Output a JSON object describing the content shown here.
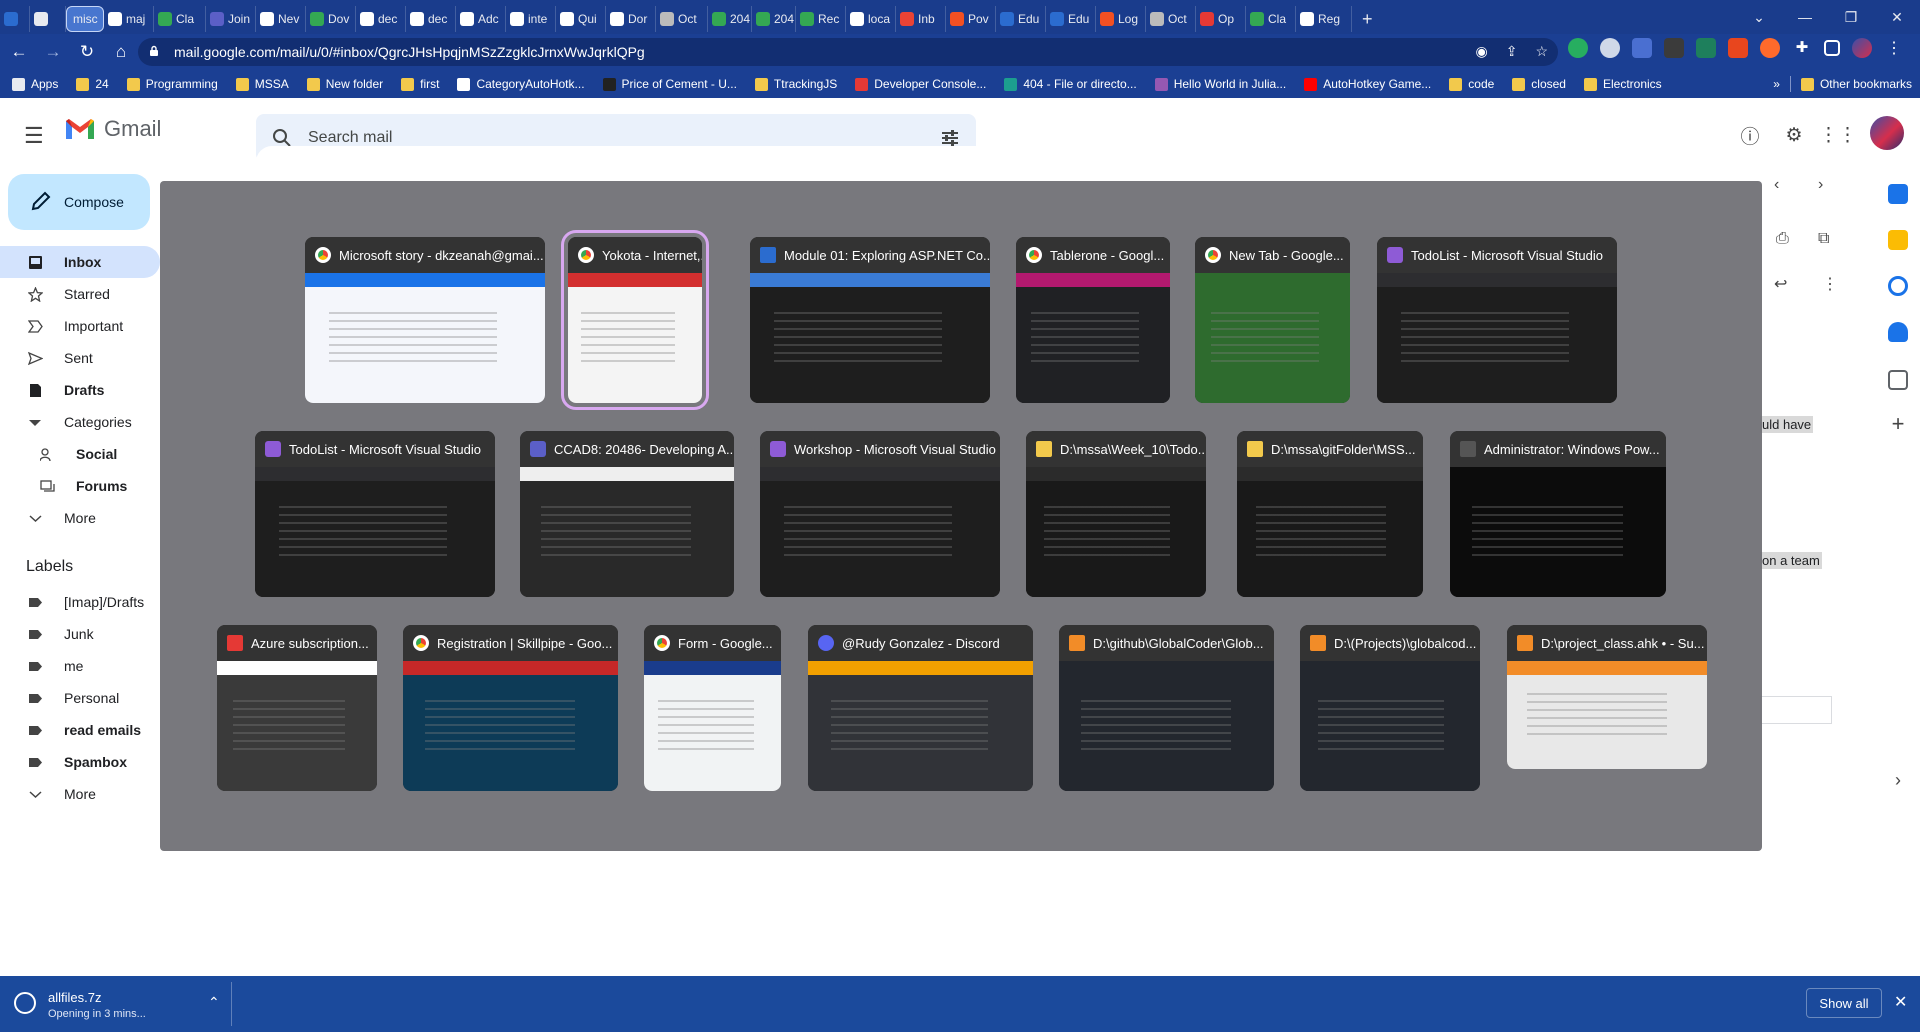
{
  "browser": {
    "tabs": [
      {
        "label": "",
        "icon": "app-icon",
        "color": "#2b6ccf"
      },
      {
        "label": "",
        "icon": "calendar-icon",
        "color": "#e8eaf0"
      },
      {
        "label": "misc",
        "icon": "",
        "color": "",
        "active": true
      },
      {
        "label": "maj",
        "icon": "github-icon",
        "color": "#ffffff"
      },
      {
        "label": "Cla",
        "icon": "check-icon",
        "color": "#34a853"
      },
      {
        "label": "Join",
        "icon": "teams-icon",
        "color": "#5b5fc7"
      },
      {
        "label": "Nev",
        "icon": "chrome-icon",
        "color": "#ffffff"
      },
      {
        "label": "Dov",
        "icon": "shield-icon",
        "color": "#34a853"
      },
      {
        "label": "dec",
        "icon": "google-icon",
        "color": "#ffffff"
      },
      {
        "label": "dec",
        "icon": "a-icon",
        "color": "#ffffff"
      },
      {
        "label": "Adc",
        "icon": "a-icon",
        "color": "#ffffff"
      },
      {
        "label": "inte",
        "icon": "google-icon",
        "color": "#ffffff"
      },
      {
        "label": "Qui",
        "icon": "a-icon",
        "color": "#ffffff"
      },
      {
        "label": "Dor",
        "icon": "github-icon",
        "color": "#ffffff"
      },
      {
        "label": "Oct",
        "icon": "octo-icon",
        "color": "#bbbbbb"
      },
      {
        "label": "204",
        "icon": "check-icon",
        "color": "#34a853"
      },
      {
        "label": "204",
        "icon": "check-icon",
        "color": "#34a853"
      },
      {
        "label": "Rec",
        "icon": "check-icon",
        "color": "#34a853"
      },
      {
        "label": "loca",
        "icon": "globe-icon",
        "color": "#ffffff"
      },
      {
        "label": "Inb",
        "icon": "gmail-icon",
        "color": "#ea4335"
      },
      {
        "label": "Pov",
        "icon": "ms-icon",
        "color": "#f25022"
      },
      {
        "label": "Edu",
        "icon": "a-icon",
        "color": "#2b6ccf"
      },
      {
        "label": "Edu",
        "icon": "a-icon",
        "color": "#2b6ccf"
      },
      {
        "label": "Log",
        "icon": "ms-icon",
        "color": "#f25022"
      },
      {
        "label": "Oct",
        "icon": "octo-icon",
        "color": "#bbbbbb"
      },
      {
        "label": "Op",
        "icon": "pdf-icon",
        "color": "#e53935"
      },
      {
        "label": "Cla",
        "icon": "check-icon",
        "color": "#34a853"
      },
      {
        "label": "Reg",
        "icon": "doc-icon",
        "color": "#ffffff"
      }
    ],
    "new_tab": "+",
    "url": "mail.google.com/mail/u/0/#inbox/QgrcJHsHpqjnMSzZzgklcJrnxWwJqrklQPg",
    "bookmarks": [
      {
        "label": "Apps",
        "icon": "grid"
      },
      {
        "label": "24",
        "icon": "folder"
      },
      {
        "label": "Programming",
        "icon": "folder"
      },
      {
        "label": "MSSA",
        "icon": "folder"
      },
      {
        "label": "New folder",
        "icon": "folder"
      },
      {
        "label": "first",
        "icon": "folder"
      },
      {
        "label": "CategoryAutoHotk...",
        "icon": "page"
      },
      {
        "label": "Price of Cement - U...",
        "icon": "iw"
      },
      {
        "label": "TtrackingJS",
        "icon": "folder"
      },
      {
        "label": "Developer Console...",
        "icon": "a-red"
      },
      {
        "label": "404 - File or directo...",
        "icon": "p-teal"
      },
      {
        "label": "Hello World in Julia...",
        "icon": "julia"
      },
      {
        "label": "AutoHotkey Game...",
        "icon": "youtube"
      },
      {
        "label": "code",
        "icon": "folder"
      },
      {
        "label": "closed",
        "icon": "folder"
      },
      {
        "label": "Electronics",
        "icon": "folder"
      }
    ],
    "bookmarks_more": "»",
    "other_bookmarks": "Other bookmarks"
  },
  "gmail": {
    "app_name": "Gmail",
    "search_placeholder": "Search mail",
    "compose": "Compose",
    "nav": [
      {
        "label": "Inbox",
        "icon": "inbox-icon",
        "active": true
      },
      {
        "label": "Starred",
        "icon": "star-icon"
      },
      {
        "label": "Important",
        "icon": "important-icon"
      },
      {
        "label": "Sent",
        "icon": "send-icon"
      },
      {
        "label": "Drafts",
        "icon": "draft-icon",
        "bold": true
      },
      {
        "label": "Categories",
        "icon": "caret-down-icon"
      },
      {
        "label": "Social",
        "icon": "people-icon",
        "bold": true,
        "sub": true
      },
      {
        "label": "Forums",
        "icon": "forum-icon",
        "bold": true,
        "sub": true
      },
      {
        "label": "More",
        "icon": "chevron-down-icon"
      }
    ],
    "labels_heading": "Labels",
    "labels": [
      {
        "label": "[Imap]/Drafts"
      },
      {
        "label": "Junk"
      },
      {
        "label": "me"
      },
      {
        "label": "Personal"
      },
      {
        "label": "read emails",
        "bold": true
      },
      {
        "label": "Spambox",
        "bold": true
      },
      {
        "label": "More",
        "chevron": true
      }
    ],
    "snippets": [
      "uld have",
      "on a team"
    ]
  },
  "switcher": {
    "windows": [
      {
        "title": "Microsoft story - dkzeanah@gmai...",
        "app": "chrome",
        "thumb": "#f4f6fb",
        "accent": "#1a73e8"
      },
      {
        "title": "Yokota - Internet,...",
        "app": "chrome",
        "thumb": "#f4f4f4",
        "accent": "#d32f2f",
        "selected": true
      },
      {
        "title": "Module 01: Exploring ASP.NET Co...",
        "app": "video",
        "thumb": "#1e1e1e",
        "accent": "#3a7bd5"
      },
      {
        "title": "Tablerone - Googl...",
        "app": "chrome",
        "thumb": "#202124",
        "accent": "#b3196f"
      },
      {
        "title": "New Tab - Google...",
        "app": "chrome",
        "thumb": "#2e6b2e",
        "accent": "#2e6b2e"
      },
      {
        "title": "TodoList - Microsoft Visual Studio",
        "app": "vs",
        "thumb": "#1e1e1e",
        "accent": "#2d2d30"
      },
      {
        "title": "TodoList - Microsoft Visual Studio",
        "app": "vs",
        "thumb": "#1e1e1e",
        "accent": "#2d2d30"
      },
      {
        "title": "CCAD8: 20486- Developing A...",
        "app": "teams",
        "thumb": "#292929",
        "accent": "#eeeeee"
      },
      {
        "title": "Workshop - Microsoft Visual Studio",
        "app": "vs",
        "thumb": "#1e1e1e",
        "accent": "#2d2d30"
      },
      {
        "title": "D:\\mssa\\Week_10\\Todo...",
        "app": "folder",
        "thumb": "#191919",
        "accent": "#2b2b2b"
      },
      {
        "title": "D:\\mssa\\gitFolder\\MSS...",
        "app": "folder",
        "thumb": "#191919",
        "accent": "#2b2b2b"
      },
      {
        "title": "Administrator: Windows Pow...",
        "app": "ps",
        "thumb": "#0c0c0c",
        "accent": "#0c0c0c"
      },
      {
        "title": "Azure subscription...",
        "app": "pdf",
        "thumb": "#3a3a3a",
        "accent": "#ffffff"
      },
      {
        "title": "Registration | Skillpipe - Goo...",
        "app": "chrome",
        "thumb": "#0d3b57",
        "accent": "#c62828"
      },
      {
        "title": "Form - Google...",
        "app": "chrome",
        "thumb": "#f1f3f4",
        "accent": "#1a3c8c"
      },
      {
        "title": "@Rudy Gonzalez - Discord",
        "app": "discord",
        "thumb": "#313338",
        "accent": "#f2a000"
      },
      {
        "title": "D:\\github\\GlobalCoder\\Glob...",
        "app": "sublime",
        "thumb": "#23272e",
        "accent": "#23272e"
      },
      {
        "title": "D:\\(Projects)\\globalcod...",
        "app": "sublime",
        "thumb": "#23272e",
        "accent": "#23272e"
      },
      {
        "title": "D:\\project_class.ahk • - Su...",
        "app": "sublime",
        "thumb": "#e8e8e8",
        "accent": "#f28c28"
      }
    ]
  },
  "downloads": {
    "filename": "allfiles.7z",
    "status": "Opening in 3 mins...",
    "show_all": "Show all"
  }
}
